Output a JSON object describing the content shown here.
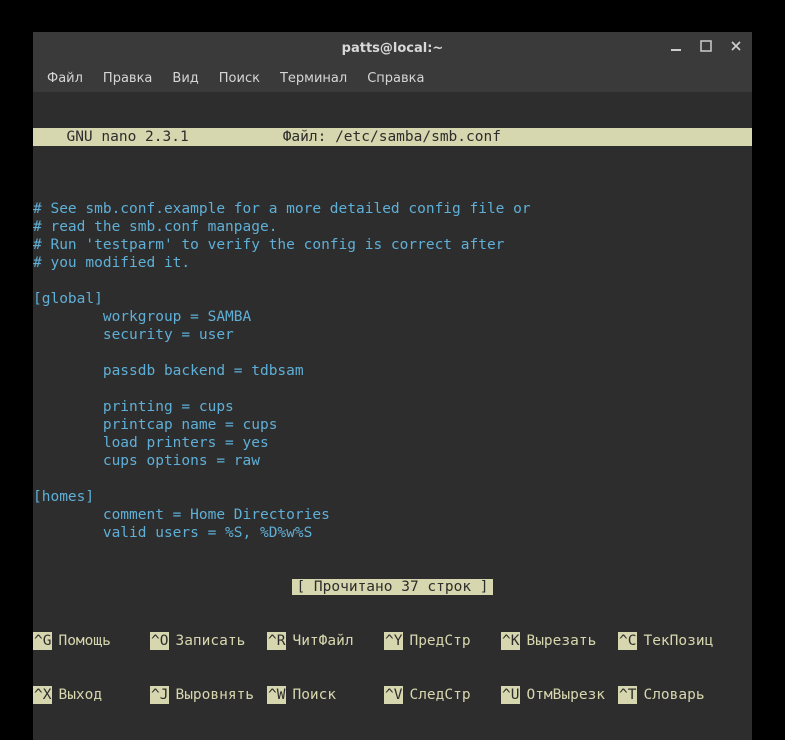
{
  "window": {
    "title": "patts@local:~"
  },
  "menubar": {
    "items": [
      "Файл",
      "Правка",
      "Вид",
      "Поиск",
      "Терминал",
      "Справка"
    ]
  },
  "nano": {
    "version": "  GNU nano 2.3.1",
    "file_label": "Файл: /etc/samba/smb.conf",
    "status": "[ Прочитано 37 строк ]",
    "content": [
      "",
      "# See smb.conf.example for a more detailed config file or",
      "# read the smb.conf manpage.",
      "# Run 'testparm' to verify the config is correct after",
      "# you modified it.",
      "",
      "[global]",
      "        workgroup = SAMBA",
      "        security = user",
      "",
      "        passdb backend = tdbsam",
      "",
      "        printing = cups",
      "        printcap name = cups",
      "        load printers = yes",
      "        cups options = raw",
      "",
      "[homes]",
      "        comment = Home Directories",
      "        valid users = %S, %D%w%S"
    ],
    "shortcuts_row1": [
      {
        "key": "^G",
        "label": "Помощь"
      },
      {
        "key": "^O",
        "label": "Записать"
      },
      {
        "key": "^R",
        "label": "ЧитФайл"
      },
      {
        "key": "^Y",
        "label": "ПредСтр"
      },
      {
        "key": "^K",
        "label": "Вырезать"
      },
      {
        "key": "^C",
        "label": "ТекПозиц"
      }
    ],
    "shortcuts_row2": [
      {
        "key": "^X",
        "label": "Выход"
      },
      {
        "key": "^J",
        "label": "Выровнять"
      },
      {
        "key": "^W",
        "label": "Поиск"
      },
      {
        "key": "^V",
        "label": "СледСтр"
      },
      {
        "key": "^U",
        "label": "ОтмВырезк"
      },
      {
        "key": "^T",
        "label": "Словарь"
      }
    ]
  }
}
